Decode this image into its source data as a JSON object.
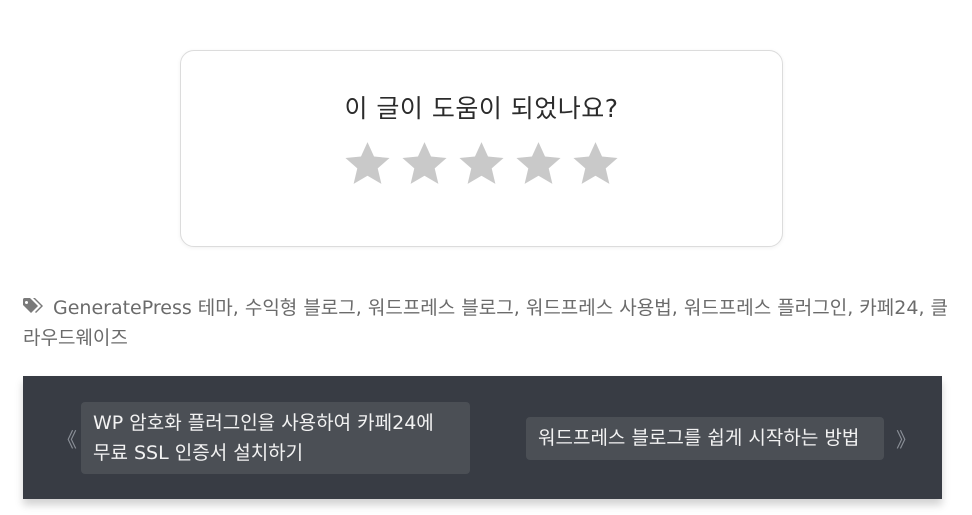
{
  "rating": {
    "question": "이 글이 도움이 되었나요?",
    "stars_total": 5,
    "stars_filled": 0,
    "star_color": "#c9c9c9"
  },
  "tags": {
    "icon": "tag-icon",
    "items": [
      "GeneratePress 테마",
      "수익형 블로그",
      "워드프레스 블로그",
      "워드프레스 사용법",
      "워드프레스 플러그인",
      "카페24",
      "클라우드웨이즈"
    ],
    "separator": ", "
  },
  "post_nav": {
    "background": "#383c44",
    "prev_arrow": "《",
    "next_arrow": "》",
    "prev": {
      "line1": "WP 암호화 플러그인을 사용하여 카페24에",
      "line2": "무료 SSL 인증서 설치하기"
    },
    "next": {
      "title": "워드프레스 블로그를 쉽게 시작하는 방법"
    }
  }
}
